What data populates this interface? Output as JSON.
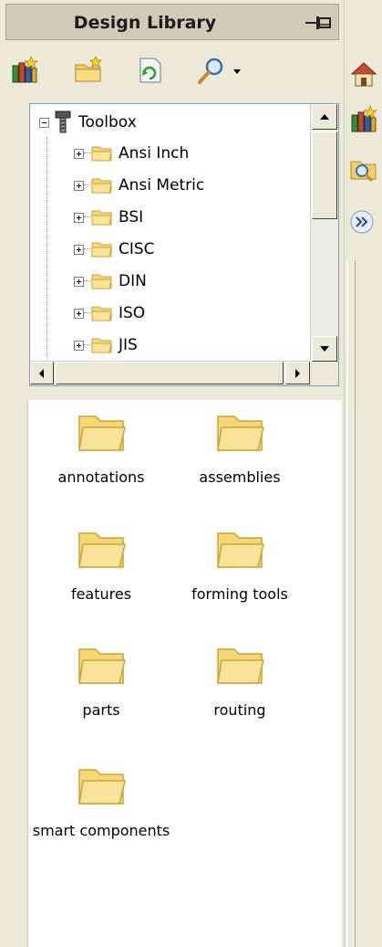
{
  "panel": {
    "title": "Design Library",
    "pin_icon": "pin-icon"
  },
  "toolbar": {
    "buttons": [
      {
        "name": "add-to-library-icon"
      },
      {
        "name": "new-folder-icon"
      },
      {
        "name": "refresh-icon"
      },
      {
        "name": "search-icon"
      },
      {
        "name": "dropdown-arrow-icon"
      }
    ]
  },
  "tree": {
    "root": {
      "label": "Toolbox",
      "icon": "toolbox-icon",
      "expanded": true
    },
    "children": [
      {
        "label": "Ansi Inch"
      },
      {
        "label": "Ansi Metric"
      },
      {
        "label": "BSI"
      },
      {
        "label": "CISC"
      },
      {
        "label": "DIN"
      },
      {
        "label": "ISO"
      },
      {
        "label": "JIS"
      }
    ]
  },
  "files": [
    {
      "label": "annotations"
    },
    {
      "label": "assemblies"
    },
    {
      "label": "features"
    },
    {
      "label": "forming tools"
    },
    {
      "label": "parts"
    },
    {
      "label": "routing"
    },
    {
      "label": "smart components"
    }
  ],
  "side_tabs": [
    {
      "name": "home-tab-icon"
    },
    {
      "name": "design-library-tab-icon"
    },
    {
      "name": "file-explorer-tab-icon"
    },
    {
      "name": "expand-chevron-icon"
    }
  ],
  "colors": {
    "folder_fill": "#f8d775",
    "folder_edge": "#c9a33a",
    "title_bar": "#cfcbb8",
    "panel_bg": "#ece9d8"
  }
}
